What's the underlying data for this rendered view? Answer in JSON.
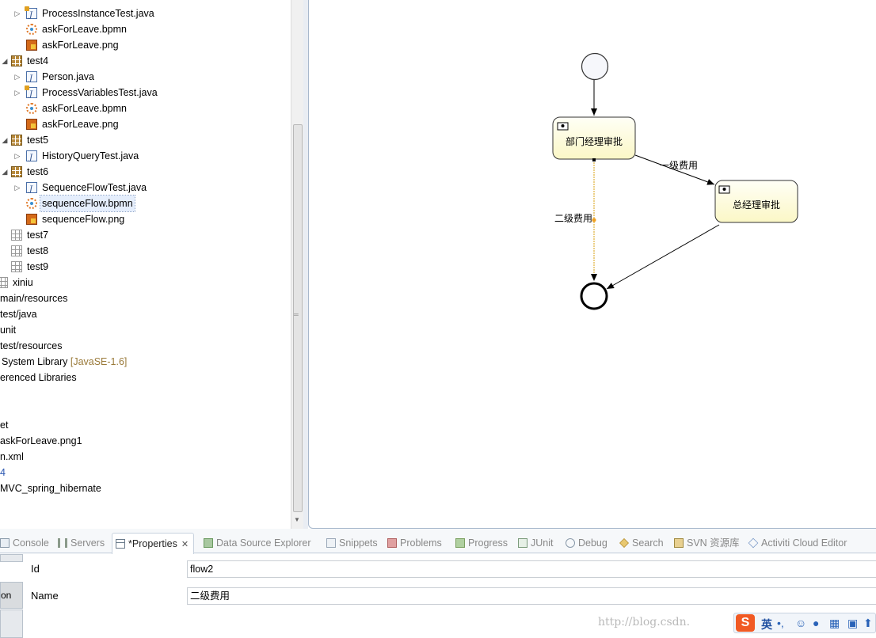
{
  "tree": {
    "rows": [
      {
        "label": "ProcessInstanceTest.java",
        "icon": "java-test-icon"
      },
      {
        "label": "askForLeave.bpmn",
        "icon": "bpmn-icon"
      },
      {
        "label": "askForLeave.png",
        "icon": "png-icon"
      },
      {
        "label": "test4",
        "icon": "package-icon"
      },
      {
        "label": "Person.java",
        "icon": "java-icon"
      },
      {
        "label": "ProcessVariablesTest.java",
        "icon": "java-test-icon"
      },
      {
        "label": "askForLeave.bpmn",
        "icon": "bpmn-icon"
      },
      {
        "label": "askForLeave.png",
        "icon": "png-icon"
      },
      {
        "label": "test5",
        "icon": "package-icon"
      },
      {
        "label": "HistoryQueryTest.java",
        "icon": "java-icon"
      },
      {
        "label": "test6",
        "icon": "package-icon"
      },
      {
        "label": "SequenceFlowTest.java",
        "icon": "java-icon"
      },
      {
        "label": "sequenceFlow.bpmn",
        "icon": "bpmn-icon"
      },
      {
        "label": "sequenceFlow.png",
        "icon": "png-icon"
      },
      {
        "label": "test7",
        "icon": "package-empty-icon"
      },
      {
        "label": "test8",
        "icon": "package-empty-icon"
      },
      {
        "label": "test9",
        "icon": "package-empty-icon"
      },
      {
        "label": "xiniu",
        "icon": "package-empty-icon"
      },
      {
        "label": "main/resources"
      },
      {
        "label": "test/java"
      },
      {
        "label": "unit"
      },
      {
        "label": "test/resources"
      },
      {
        "label": "System Library ",
        "decoration": "[JavaSE-1.6]"
      },
      {
        "label": "erenced Libraries"
      },
      {
        "label": "et"
      },
      {
        "label": "askForLeave.png1"
      },
      {
        "label": "n.xml"
      },
      {
        "label": "4"
      },
      {
        "label": "MVC_spring_hibernate"
      }
    ]
  },
  "diagram": {
    "task_manager": "部门经理审批",
    "task_general": "总经理审批",
    "flow_level1": "一级费用",
    "flow_level2": "二级费用"
  },
  "tabs": [
    {
      "label": "Console",
      "icon": "console-icon"
    },
    {
      "label": "Servers",
      "icon": "servers-icon"
    },
    {
      "label": "*Properties",
      "icon": "properties-icon",
      "active": true
    },
    {
      "label": "Data Source Explorer",
      "icon": "data-source-icon"
    },
    {
      "label": "Snippets",
      "icon": "snippets-icon"
    },
    {
      "label": "Problems",
      "icon": "problems-icon"
    },
    {
      "label": "Progress",
      "icon": "progress-icon"
    },
    {
      "label": "JUnit",
      "icon": "junit-icon"
    },
    {
      "label": "Debug",
      "icon": "debug-icon"
    },
    {
      "label": "Search",
      "icon": "search-icon"
    },
    {
      "label": "SVN 资源库",
      "icon": "svn-icon"
    },
    {
      "label": "Activiti Cloud Editor",
      "icon": "activiti-icon"
    }
  ],
  "properties": {
    "id_label": "Id",
    "id_value": "flow2",
    "name_label": "Name",
    "name_value": "二级费用",
    "side_tab_partial": "on"
  },
  "watermark": "http://blog.csdn.",
  "ime": {
    "logo": "S",
    "lang": "英"
  }
}
